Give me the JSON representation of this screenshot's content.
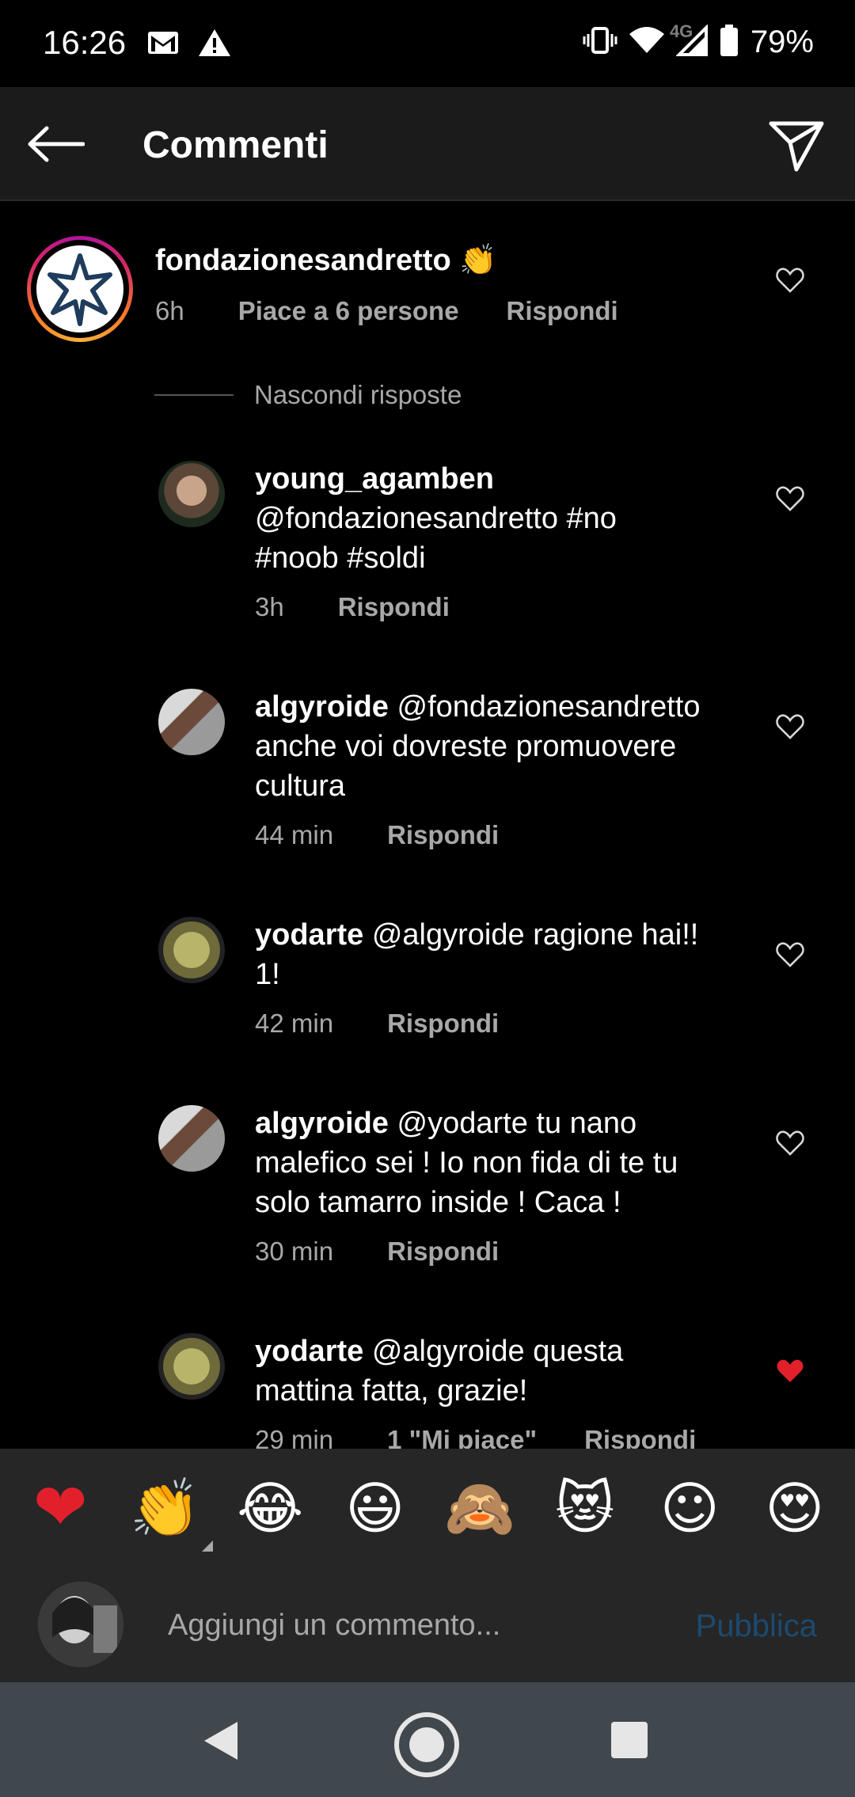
{
  "status_bar": {
    "time": "16:26",
    "network": "4G",
    "battery": "79%"
  },
  "header": {
    "title": "Commenti"
  },
  "main_comment": {
    "username": "fondazionesandretto",
    "emoji": "👏",
    "time": "6h",
    "likes": "Piace a 6 persone",
    "reply": "Rispondi"
  },
  "hide_replies": "Nascondi risposte",
  "replies": [
    {
      "username": "young_agamben",
      "mention": "",
      "text_line1": "@fondazionesandretto #no",
      "text_line2": "#noob #soldi",
      "text_line3": "",
      "time": "3h",
      "likes": "",
      "reply": "Rispondi",
      "liked": false
    },
    {
      "username": "algyroide",
      "mention": "@fondazionesandretto",
      "text_line1": "",
      "text_line2": "anche voi dovreste promuovere",
      "text_line3": "cultura",
      "time": "44 min",
      "likes": "",
      "reply": "Rispondi",
      "liked": false
    },
    {
      "username": "yodarte",
      "mention": "@algyroide",
      "text_line1": "ragione hai!!",
      "text_line2": "1!",
      "text_line3": "",
      "time": "42 min",
      "likes": "",
      "reply": "Rispondi",
      "liked": false
    },
    {
      "username": "algyroide",
      "mention": "@yodarte",
      "text_line1": "tu nano",
      "text_line2": "malefico sei !  Io non fida di te tu",
      "text_line3": "solo tamarro inside ! Caca !",
      "time": "30 min",
      "likes": "",
      "reply": "Rispondi",
      "liked": false
    },
    {
      "username": "yodarte",
      "mention": "@algyroide",
      "text_line1": "questa",
      "text_line2": "mattina fatta, grazie!",
      "text_line3": "",
      "time": "29 min",
      "likes": "1 \"Mi piace\"",
      "reply": "Rispondi",
      "liked": true
    }
  ],
  "emoji_bar": [
    "❤",
    "👏",
    "😂",
    "😃",
    "🙈",
    "😻",
    "☺",
    "😍"
  ],
  "comment_input": {
    "placeholder": "Aggiungi un commento...",
    "publish": "Pubblica"
  },
  "colors": {
    "accent_blue_disabled": "#1c4a70",
    "like_red": "#e2202c",
    "muted_text": "#a8a8a8"
  }
}
